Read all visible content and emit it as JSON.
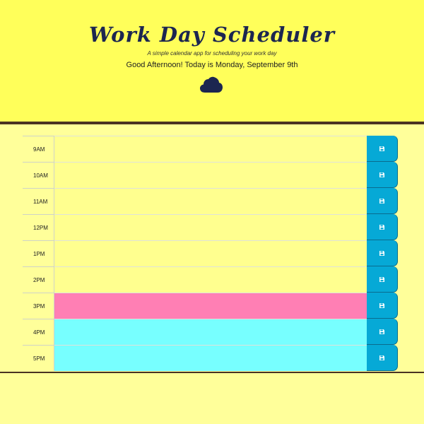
{
  "header": {
    "title": "Work Day Scheduler",
    "subtitle": "A simple calendar app for scheduling your work day",
    "current_day": "Good Afternoon! Today is Monday, September 9th",
    "weather_icon": "cloud-icon"
  },
  "rows": [
    {
      "hour": "9AM",
      "text": "",
      "status": "past"
    },
    {
      "hour": "10AM",
      "text": "",
      "status": "past"
    },
    {
      "hour": "11AM",
      "text": "",
      "status": "past"
    },
    {
      "hour": "12PM",
      "text": "",
      "status": "past"
    },
    {
      "hour": "1PM",
      "text": "",
      "status": "past"
    },
    {
      "hour": "2PM",
      "text": "",
      "status": "past"
    },
    {
      "hour": "3PM",
      "text": "",
      "status": "present"
    },
    {
      "hour": "4PM",
      "text": "",
      "status": "future"
    },
    {
      "hour": "5PM",
      "text": "",
      "status": "future"
    }
  ],
  "colors": {
    "header_bg": "#FFFF5A",
    "page_bg": "#FFFF9A",
    "title": "#1c2650",
    "past": "#FFFF8F",
    "present": "#FF7FB4",
    "future": "#77FFFF",
    "save_button": "#06A9D6",
    "divider": "#4a3323"
  },
  "icons": {
    "save": "save-icon"
  }
}
